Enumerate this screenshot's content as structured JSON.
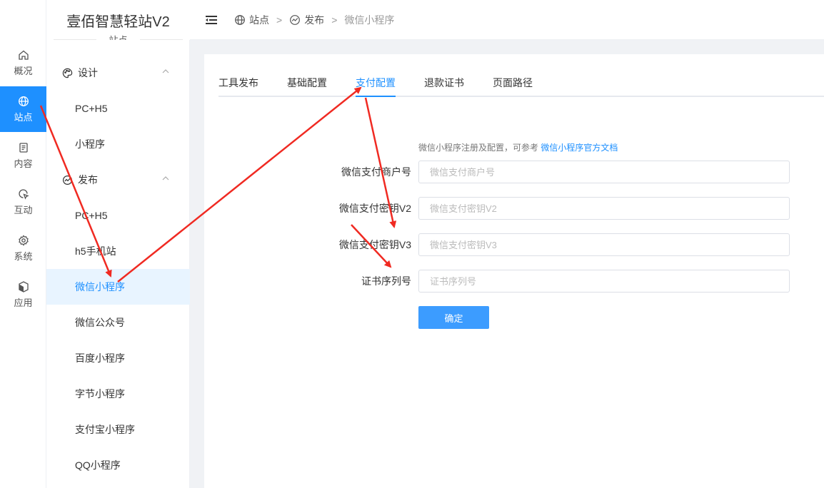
{
  "brand": {
    "title": "壹佰智慧轻站V2",
    "subtitle": "站点"
  },
  "rail": [
    {
      "label": "概况",
      "icon": "home-icon"
    },
    {
      "label": "站点",
      "icon": "globe-icon"
    },
    {
      "label": "内容",
      "icon": "document-icon"
    },
    {
      "label": "互动",
      "icon": "pointer-icon"
    },
    {
      "label": "系统",
      "icon": "gear-icon"
    },
    {
      "label": "应用",
      "icon": "cube-icon"
    }
  ],
  "sidebar": {
    "design_label": "设计",
    "design_items": [
      "PC+H5",
      "小程序"
    ],
    "publish_label": "发布",
    "publish_items": [
      "PC+H5",
      "h5手机站",
      "微信小程序",
      "微信公众号",
      "百度小程序",
      "字节小程序",
      "支付宝小程序",
      "QQ小程序"
    ]
  },
  "breadcrumb": {
    "first": "站点",
    "second": "发布",
    "third": "微信小程序",
    "sep": ">"
  },
  "tabs": [
    "工具发布",
    "基础配置",
    "支付配置",
    "退款证书",
    "页面路径"
  ],
  "form": {
    "hint_text": "微信小程序注册及配置，可参考",
    "hint_link": "微信小程序官方文档",
    "fields": [
      {
        "label": "微信支付商户号",
        "placeholder": "微信支付商户号",
        "value": ""
      },
      {
        "label": "微信支付密钥V2",
        "placeholder": "微信支付密钥V2",
        "value": ""
      },
      {
        "label": "微信支付密钥V3",
        "placeholder": "微信支付密钥V3",
        "value": ""
      },
      {
        "label": "证书序列号",
        "placeholder": "证书序列号",
        "value": ""
      }
    ],
    "submit_label": "确定"
  },
  "colors": {
    "accent": "#1e90ff",
    "button": "#3c9cff",
    "arrow": "#f02a22"
  }
}
